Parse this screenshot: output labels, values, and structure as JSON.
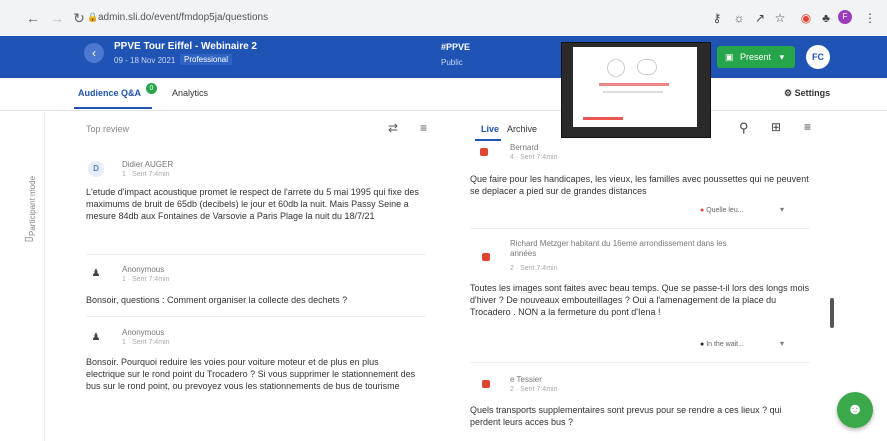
{
  "browser": {
    "url": "admin.sli.do/event/fmdop5ja/questions",
    "icons": [
      "back-arrow",
      "forward-arrow",
      "reload",
      "lock",
      "key",
      "translate",
      "share",
      "star",
      "extension",
      "puzzle",
      "profile",
      "menu"
    ]
  },
  "event": {
    "title": "PPVE Tour Eiffel - Webinaire 2",
    "dates": "09 - 18 Nov 2021",
    "plan": "Professional",
    "hashtag": "#PPVE",
    "visibility": "Public",
    "present_label": "Present",
    "user_initials": "FC"
  },
  "tabs": {
    "audience_qa": "Audience Q&A",
    "analytics": "Analytics",
    "settings": "Settings",
    "badge": "0"
  },
  "rail": {
    "label": "Participant mode"
  },
  "left": {
    "sort_label": "Top review",
    "questions": [
      {
        "avatar": "D",
        "name": "Didier AUGER",
        "meta": "1 · Sent 7:4min",
        "text": "L'etude d'impact acoustique promet le respect de l'arrete du 5 mai 1995 qui fixe des maximums de bruit de 65db (decibels) le jour et 60db la nuit. Mais Passy Seine a mesure 84db aux Fontaines de Varsovie a Paris Plage la nuit du 18/7/21"
      },
      {
        "avatar": "person",
        "name": "Anonymous",
        "meta": "1 · Sent 7:4min",
        "text": "Bonsoir, questions : Comment organiser la collecte des dechets ?"
      },
      {
        "avatar": "person",
        "name": "Anonymous",
        "meta": "1 · Sent 7:4min",
        "text": "Bonsoir. Pourquoi reduire les voies pour voiture moteur et de plus en plus electrique sur le rond point du Trocadero ? Si vous supprimer le stationnement des bus sur le rond point, ou prevoyez vous les stationnements de bus de tourisme"
      }
    ]
  },
  "right": {
    "tab_live": "Live",
    "tab_archive": "Archive",
    "questions": [
      {
        "name": "Bernard",
        "meta": "4 · Sent 7:4min",
        "text": "Que faire pour les handicapes, les vieux, les familles avec poussettes qui ne peuvent se deplacer a pied sur de grandes distances",
        "select": "Quelle leu..."
      },
      {
        "name": "Richard Metzger habitant du 16eme arrondissement dans les années",
        "meta": "2 · Sent 7:4min",
        "text": "Toutes les images sont faites avec beau temps. Que se passe-t-il lors des longs mois d'hiver ? De nouveaux embouteillages ? Oui a l'amenagement de la place du Trocadero . NON a la fermeture du pont d'Iena !",
        "select": "In the wait..."
      },
      {
        "name": "e Tessier",
        "meta": "2 · Sent 7:4min",
        "text": "Quels transports supplementaires sont prevus pour se rendre a ces lieux ? qui perdent leurs acces bus ?",
        "select": ""
      }
    ]
  }
}
